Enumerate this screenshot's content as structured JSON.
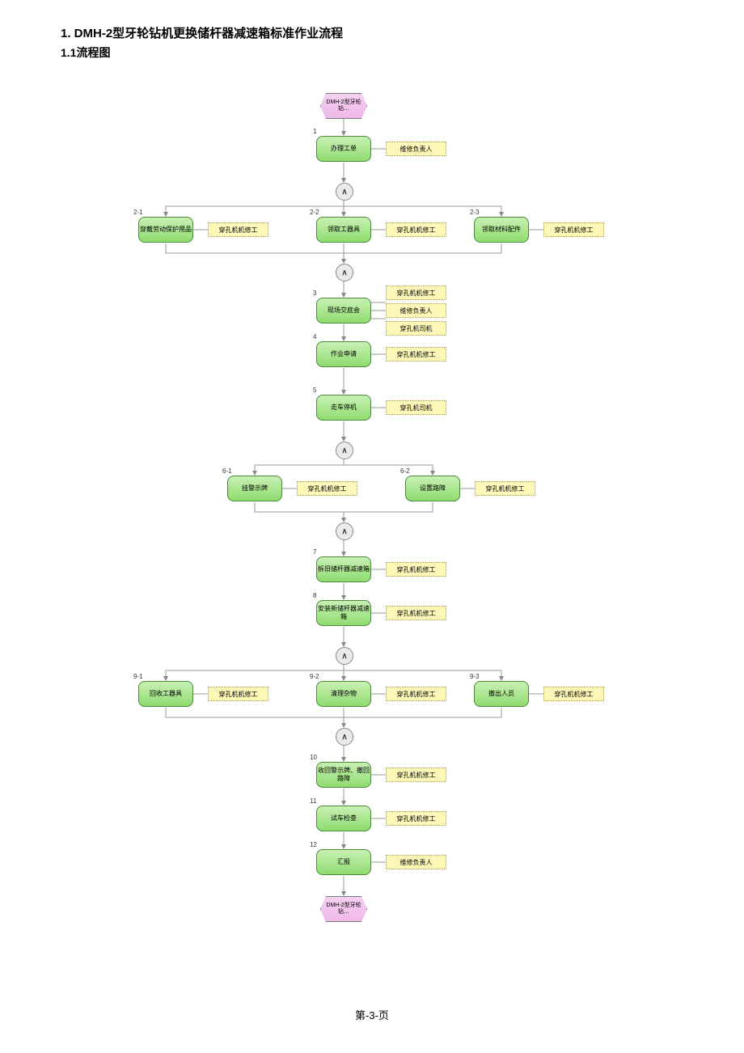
{
  "heading1": "1.  DMH-2型牙轮钻机更换储杆器减速箱标准作业流程",
  "heading2": "1.1流程图",
  "footer": "第-3-页",
  "startHex": "DMH-2型牙轮钻…",
  "endHex": "DMH-2型牙轮钻…",
  "gateSymbol": "∧",
  "roles": {
    "maint_lead": "维修负责人",
    "drill_mech": "穿孔机机修工",
    "drill_driver": "穿孔机司机"
  },
  "steps": {
    "s1": {
      "num": "1",
      "label": "办理工单",
      "roles": [
        "maint_lead"
      ]
    },
    "s21": {
      "num": "2-1",
      "label": "穿戴劳动保护用品",
      "roles": [
        "drill_mech"
      ]
    },
    "s22": {
      "num": "2-2",
      "label": "领取工器具",
      "roles": [
        "drill_mech"
      ]
    },
    "s23": {
      "num": "2-3",
      "label": "领取材料配件",
      "roles": [
        "drill_mech"
      ]
    },
    "s3": {
      "num": "3",
      "label": "现场交底会",
      "roles": [
        "drill_mech",
        "maint_lead",
        "drill_driver"
      ]
    },
    "s4": {
      "num": "4",
      "label": "作业申请",
      "roles": [
        "drill_mech"
      ]
    },
    "s5": {
      "num": "5",
      "label": "走车停机",
      "roles": [
        "drill_driver"
      ]
    },
    "s61": {
      "num": "6-1",
      "label": "挂警示牌",
      "roles": [
        "drill_mech"
      ]
    },
    "s62": {
      "num": "6-2",
      "label": "设置路障",
      "roles": [
        "drill_mech"
      ]
    },
    "s7": {
      "num": "7",
      "label": "拆旧储杆器减速箱",
      "roles": [
        "drill_mech"
      ]
    },
    "s8": {
      "num": "8",
      "label": "安装新储杆器减速箱",
      "roles": [
        "drill_mech"
      ]
    },
    "s91": {
      "num": "9-1",
      "label": "回收工器具",
      "roles": [
        "drill_mech"
      ]
    },
    "s92": {
      "num": "9-2",
      "label": "清理杂物",
      "roles": [
        "drill_mech"
      ]
    },
    "s93": {
      "num": "9-3",
      "label": "撤出人员",
      "roles": [
        "drill_mech"
      ]
    },
    "s10": {
      "num": "10",
      "label": "收回警示牌、撤回路障",
      "roles": [
        "drill_mech"
      ]
    },
    "s11": {
      "num": "11",
      "label": "试车检查",
      "roles": [
        "drill_mech"
      ]
    },
    "s12": {
      "num": "12",
      "label": "汇报",
      "roles": [
        "maint_lead"
      ]
    }
  }
}
